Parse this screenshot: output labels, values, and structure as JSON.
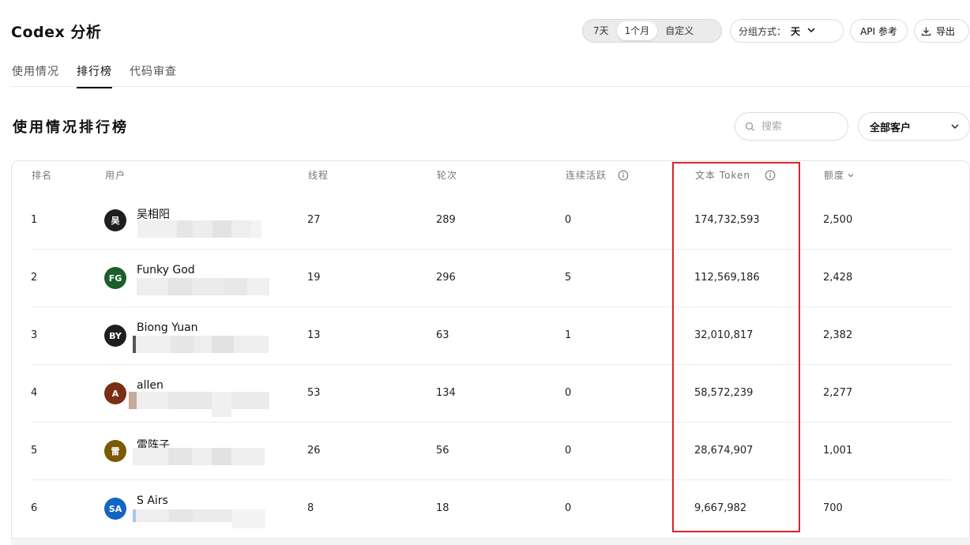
{
  "header": {
    "title": "Codex 分析",
    "range_options": [
      "7天",
      "1个月",
      "自定义"
    ],
    "range_active": 1,
    "group_label": "分组方式：",
    "group_value": "天",
    "api_label": "API 参考",
    "export_label": "导出"
  },
  "tabs": [
    {
      "label": "使用情况",
      "active": false
    },
    {
      "label": "排行榜",
      "active": true
    },
    {
      "label": "代码审查",
      "active": false
    }
  ],
  "leaderboard": {
    "title": "使用情况排行榜",
    "search_placeholder": "搜索",
    "client_filter": "全部客户",
    "columns": {
      "rank": "排名",
      "user": "用户",
      "threads": "线程",
      "turns": "轮次",
      "streak": "连续活跃",
      "text_tokens": "文本 Token",
      "quota": "额度"
    },
    "rows": [
      {
        "rank": "1",
        "initials": "吴",
        "name": "吴相阳",
        "avatar_color": "#1f1f1f",
        "threads": "27",
        "turns": "289",
        "streak": "0",
        "tokens": "174,732,593",
        "quota": "2,500"
      },
      {
        "rank": "2",
        "initials": "FG",
        "name": "Funky God",
        "avatar_color": "#1b5e2a",
        "threads": "19",
        "turns": "296",
        "streak": "5",
        "tokens": "112,569,186",
        "quota": "2,428"
      },
      {
        "rank": "3",
        "initials": "BY",
        "name": "Biong Yuan",
        "avatar_color": "#1f1f1f",
        "threads": "13",
        "turns": "63",
        "streak": "1",
        "tokens": "32,010,817",
        "quota": "2,382"
      },
      {
        "rank": "4",
        "initials": "A",
        "name": "allen",
        "avatar_color": "#7a2e14",
        "threads": "53",
        "turns": "134",
        "streak": "0",
        "tokens": "58,572,239",
        "quota": "2,277"
      },
      {
        "rank": "5",
        "initials": "雷",
        "name": "雷阵子",
        "avatar_color": "#7a5a06",
        "threads": "26",
        "turns": "56",
        "streak": "0",
        "tokens": "28,674,907",
        "quota": "1,001"
      },
      {
        "rank": "6",
        "initials": "SA",
        "name": "S Airs",
        "avatar_color": "#1565c0",
        "threads": "8",
        "turns": "18",
        "streak": "0",
        "tokens": "9,667,982",
        "quota": "700"
      }
    ]
  },
  "colors": {
    "highlight": "#d9262c",
    "divider": "#ececec"
  }
}
